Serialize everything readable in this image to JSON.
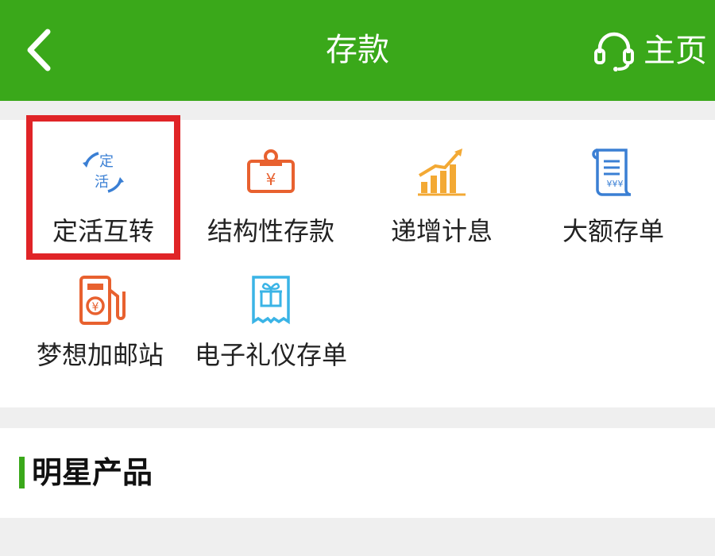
{
  "header": {
    "title": "存款",
    "home_label": "主页"
  },
  "icons": {
    "back": "chevron-left-icon",
    "home": "headset-icon"
  },
  "colors": {
    "header_bg": "#3aa81a",
    "highlight": "#e02427",
    "blue_icon": "#3a7fd4",
    "orange_icon": "#e8612f",
    "yellow_icon": "#f3a934",
    "cyan_icon": "#3ab4e6"
  },
  "services": [
    {
      "label": "定活互转",
      "icon": "fixed-current-transfer-icon",
      "icon_text_top": "定",
      "icon_text_bottom": "活",
      "highlighted": true
    },
    {
      "label": "结构性存款",
      "icon": "yuan-badge-icon",
      "icon_text": "¥"
    },
    {
      "label": "递增计息",
      "icon": "rising-bars-icon"
    },
    {
      "label": "大额存单",
      "icon": "scroll-certificate-icon",
      "icon_text": "¥¥¥"
    },
    {
      "label": "梦想加邮站",
      "icon": "fuel-pump-icon",
      "icon_text": "¥"
    },
    {
      "label": "电子礼仪存单",
      "icon": "gift-receipt-icon"
    }
  ],
  "section": {
    "title": "明星产品"
  }
}
